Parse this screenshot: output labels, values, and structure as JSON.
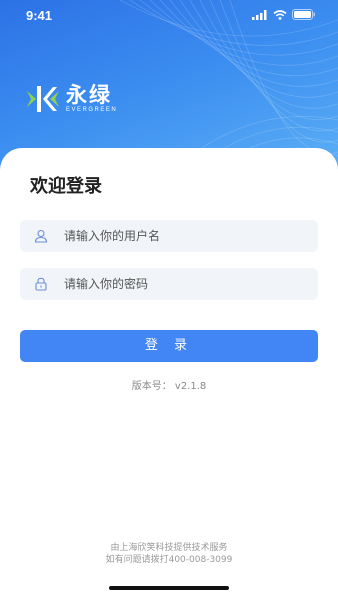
{
  "status_bar": {
    "time": "9:41"
  },
  "brand": {
    "name_cn": "永绿",
    "name_en": "EVERGREEN",
    "color_primary": "#4285f4"
  },
  "login": {
    "title": "欢迎登录",
    "username_placeholder": "请输入你的用户名",
    "password_placeholder": "请输入你的密码",
    "submit_label": "登 录",
    "version": "版本号： v2.1.8"
  },
  "footer": {
    "provider": "由上海欣笑科技提供技术服务",
    "contact": "如有问题请拨打400-008-3099"
  }
}
